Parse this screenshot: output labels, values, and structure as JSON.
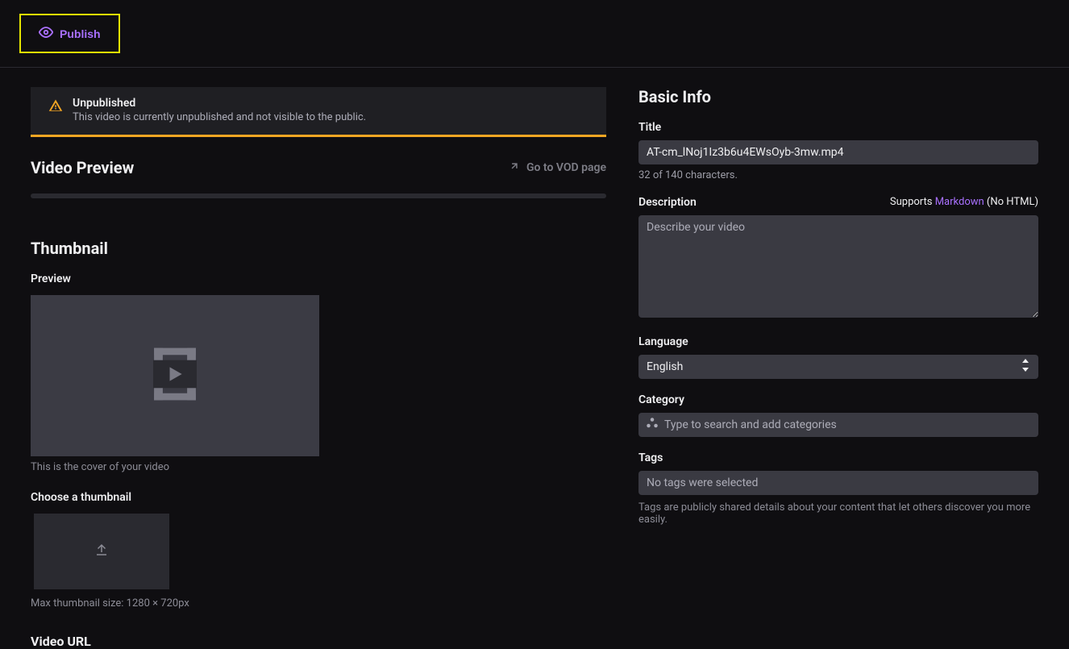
{
  "header": {
    "publish_label": "Publish"
  },
  "alert": {
    "title": "Unpublished",
    "description": "This video is currently unpublished and not visible to the public."
  },
  "left": {
    "video_preview_title": "Video Preview",
    "vod_link_label": "Go to VOD page",
    "thumbnail_title": "Thumbnail",
    "preview_label": "Preview",
    "preview_hint": "This is the cover of your video",
    "choose_label": "Choose a thumbnail",
    "max_size_hint": "Max thumbnail size: 1280 × 720px",
    "video_url_title": "Video URL"
  },
  "right": {
    "basic_info_title": "Basic Info",
    "title_label": "Title",
    "title_value": "AT-cm_lNoj1Iz3b6u4EWsOyb-3mw.mp4",
    "char_count": "32 of 140 characters.",
    "description_label": "Description",
    "description_note_prefix": "Supports ",
    "description_markdown": "Markdown",
    "description_note_suffix": " (No HTML)",
    "description_placeholder": "Describe your video",
    "language_label": "Language",
    "language_value": "English",
    "category_label": "Category",
    "category_placeholder": "Type to search and add categories",
    "tags_label": "Tags",
    "tags_placeholder": "No tags were selected",
    "tags_hint": "Tags are publicly shared details about your content that let others discover you more easily."
  }
}
